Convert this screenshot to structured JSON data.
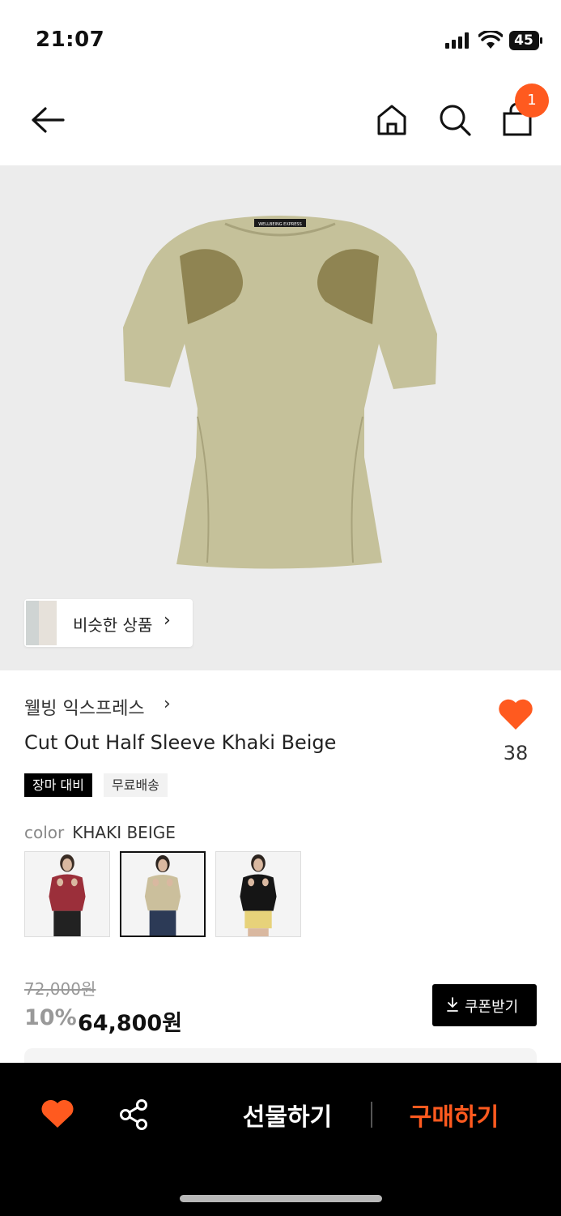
{
  "status_bar": {
    "time": "21:07",
    "battery": "45",
    "icons": [
      "signal-icon",
      "wifi-icon",
      "battery-icon"
    ]
  },
  "nav": {
    "icons": [
      "back-arrow-icon",
      "home-icon",
      "search-icon",
      "shopping-bag-icon"
    ],
    "cart_badge": "1"
  },
  "product_image": {
    "label_text": "WELLBEING EXPRESS",
    "similar_products_label": "비슷한 상품",
    "similar_chevron": "›"
  },
  "product": {
    "brand": "웰빙 익스프레스",
    "brand_chevron": "›",
    "title": "Cut Out Half Sleeve Khaki Beige",
    "like_count": "38",
    "tags": [
      "장마 대비",
      "무료배송"
    ],
    "color_label": "color",
    "color_value": "KHAKI BEIGE",
    "swatches": [
      {
        "name": "red",
        "selected": false
      },
      {
        "name": "khaki-beige",
        "selected": true
      },
      {
        "name": "black",
        "selected": false
      }
    ],
    "original_price": "72,000원",
    "discount": "10%",
    "price": "64,800원",
    "coupon_label": "쿠폰받기"
  },
  "bottom_bar": {
    "gift_label": "선물하기",
    "buy_label": "구매하기"
  },
  "colors": {
    "accent": "#ff5a1f",
    "shirt": "#c5c19a",
    "shirt_dark": "#8f8452"
  }
}
